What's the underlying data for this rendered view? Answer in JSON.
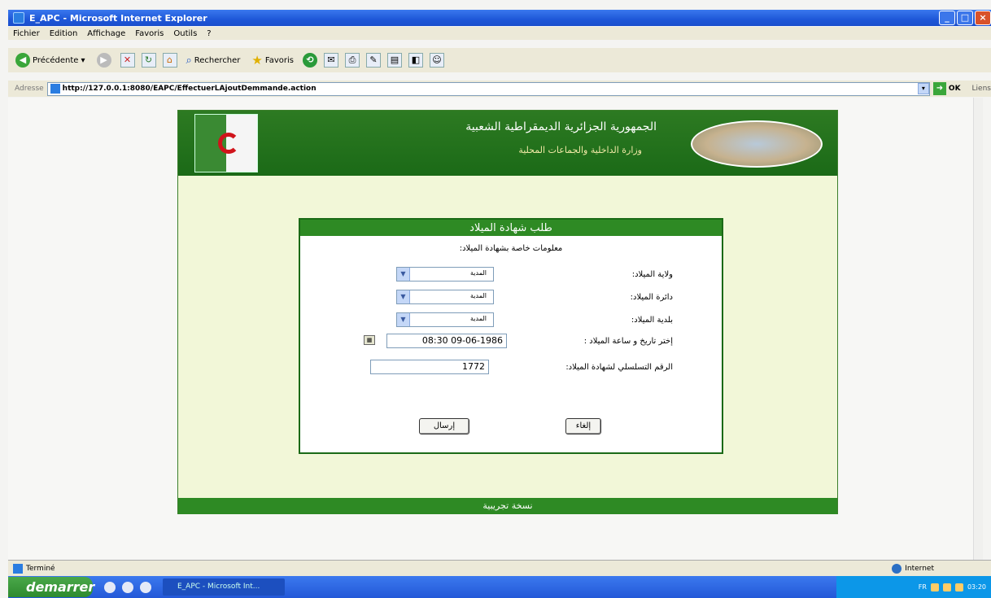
{
  "window": {
    "title": "E_APC - Microsoft Internet Explorer",
    "buttons": {
      "minimize": "_",
      "maximize": "□",
      "close": "×"
    }
  },
  "menu": [
    "Fichier",
    "Edition",
    "Affichage",
    "Favoris",
    "Outils",
    "?"
  ],
  "toolbar": {
    "back": "Précédente",
    "search": "Rechercher",
    "favorites": "Favoris"
  },
  "address": {
    "label": "Adresse",
    "url": "http://127.0.0.1:8080/EAPC/EffectuerLAjoutDemmande.action",
    "go": "OK",
    "links": "Liens"
  },
  "page": {
    "header_line1": "الجمهورية الجزائرية الديمقراطية الشعبية",
    "header_line2": "وزارة الداخلية والجماعات المحلية",
    "form_title": "طلب شهادة الميلاد",
    "section_label": "معلومات خاصة بشهادة الميلاد:",
    "fields": {
      "wilaya_label": "ولاية الميلاد:",
      "wilaya_value": "المدية",
      "daira_label": "دائرة الميلاد:",
      "daira_value": "المدية",
      "commune_label": "بلدية الميلاد:",
      "commune_value": "المدية",
      "datetime_label": "إختر تاريخ و ساعة الميلاد :",
      "datetime_value": "08:30 09-06-1986",
      "serial_label": "الرقم التسلسلي لشهادة الميلاد:",
      "serial_value": "1772"
    },
    "send_button": "إرسال",
    "cancel_button": "إلغاء",
    "footer": "نسخة تجريبية"
  },
  "status": {
    "left": "Terminé",
    "zone": "Internet"
  },
  "taskbar": {
    "start": "demarrer",
    "task": "E_APC - Microsoft Int...",
    "lang": "FR",
    "clock": "03:20"
  }
}
